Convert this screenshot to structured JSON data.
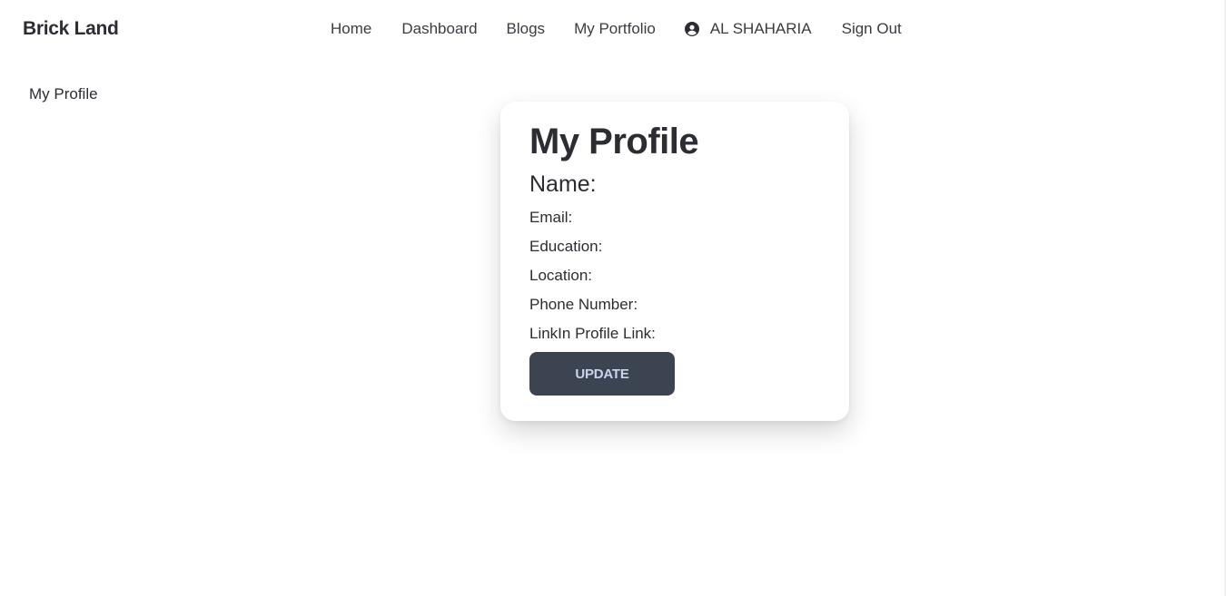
{
  "header": {
    "brand": "Brick Land",
    "nav": {
      "home": "Home",
      "dashboard": "Dashboard",
      "blogs": "Blogs",
      "portfolio": "My Portfolio",
      "user_name": "AL SHAHARIA",
      "user_icon": "user-circle-icon",
      "sign_out": "Sign Out"
    }
  },
  "sidebar": {
    "items": [
      {
        "label": "My Profile"
      }
    ]
  },
  "profile_card": {
    "title": "My Profile",
    "name_label": "Name:",
    "fields": {
      "email": "Email:",
      "education": "Education:",
      "location": "Location:",
      "phone": "Phone Number:",
      "linkedin": "LinkIn Profile Link:"
    },
    "update_label": "UPDATE"
  },
  "colors": {
    "text": "#2b2d33",
    "button_bg": "#3d4451",
    "button_text": "#c9d3ef"
  }
}
